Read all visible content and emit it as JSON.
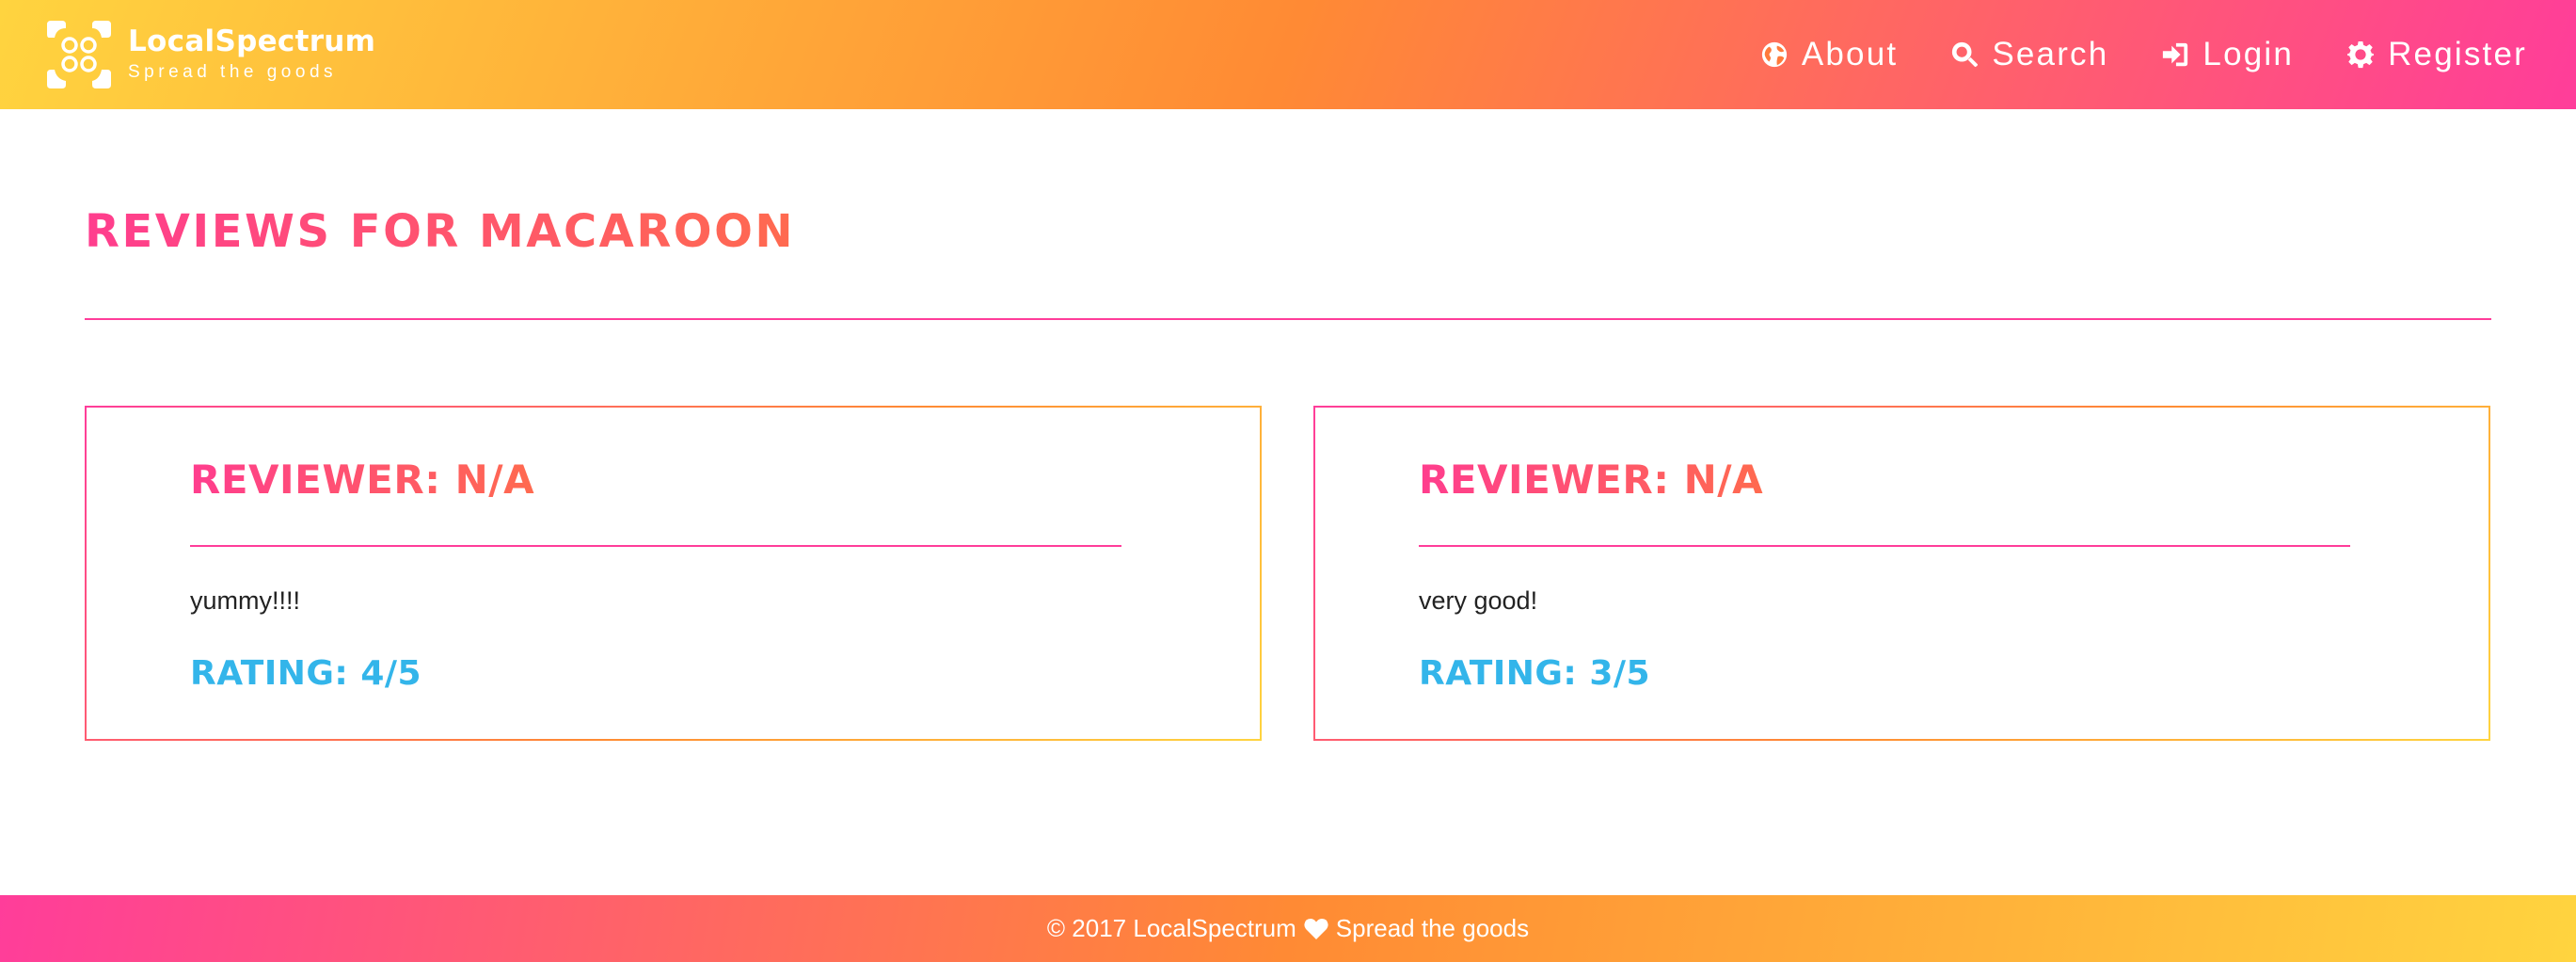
{
  "brand": {
    "name": "LocalSpectrum",
    "tagline": "Spread the goods"
  },
  "nav": [
    {
      "label": "About",
      "icon": "globe-icon"
    },
    {
      "label": "Search",
      "icon": "search-icon"
    },
    {
      "label": "Login",
      "icon": "login-icon"
    },
    {
      "label": "Register",
      "icon": "gear-icon"
    }
  ],
  "page": {
    "title": "REVIEWS FOR MACAROON"
  },
  "reviews": [
    {
      "reviewer": "REVIEWER: N/A",
      "comment": "yummy!!!!",
      "rating": "RATING: 4/5"
    },
    {
      "reviewer": "REVIEWER: N/A",
      "comment": "very good!",
      "rating": "RATING: 3/5"
    }
  ],
  "footer": {
    "copyright": "© 2017 LocalSpectrum",
    "icon": "heart-icon",
    "tagline": "Spread the goods"
  },
  "colors": {
    "gradient_yellow": "#ffd43f",
    "gradient_orange": "#ff8a34",
    "gradient_pink": "#ff3d9a",
    "rating_blue": "#33b5ea"
  }
}
